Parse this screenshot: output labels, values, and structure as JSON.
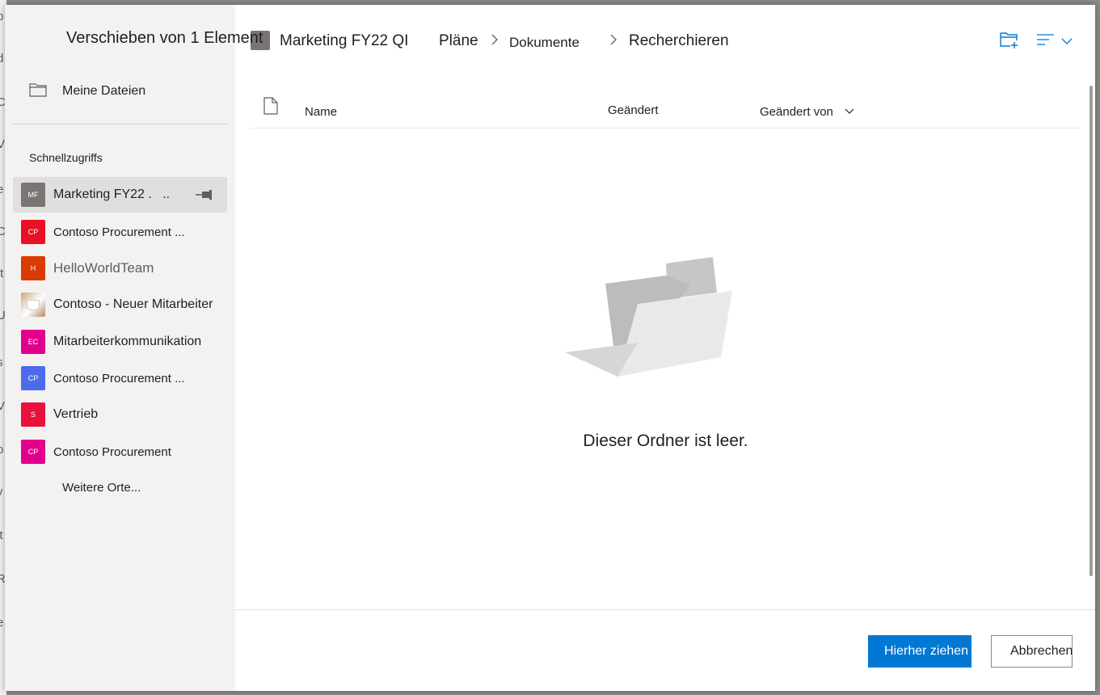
{
  "dialog": {
    "title": "Verschieben von 1 Element"
  },
  "sidebar": {
    "my_files": "Meine Dateien",
    "quick_access_header": "Schnellzugriffs",
    "items": [
      {
        "initials": "MF",
        "label": "Marketing FY22 .   ..",
        "color": "#7a7574",
        "selected": true
      },
      {
        "initials": "CP",
        "label": "Contoso Procurement ...",
        "color": "#e81123"
      },
      {
        "initials": "H",
        "label": "HelloWorldTeam",
        "color": "#da3b01"
      },
      {
        "initials": "",
        "label": "Contoso - Neuer Mitarbeiter",
        "color": "#c8a27a"
      },
      {
        "initials": "EC",
        "label": "Mitarbeiterkommunikation",
        "color": "#e3008c"
      },
      {
        "initials": "CP",
        "label": "Contoso Procurement ...",
        "color": "#4f6bed"
      },
      {
        "initials": "S",
        "label": "Vertrieb",
        "color": "#e8123c"
      },
      {
        "initials": "CP",
        "label": "Contoso Procurement",
        "color": "#e3008c"
      }
    ],
    "more_places": "Weitere Orte..."
  },
  "breadcrumb": {
    "items": [
      "Marketing FY22 QI",
      "Pläne",
      "Dokumente",
      "Recherchieren"
    ]
  },
  "table": {
    "columns": {
      "name": "Name",
      "modified": "Geändert",
      "modified_by": "Geändert von"
    }
  },
  "empty_state": {
    "message": "Dieser Ordner ist leer."
  },
  "footer": {
    "move_here_label": "Hierher ziehen",
    "cancel_label": "Abbrechen"
  },
  "backdrop": {
    "letters": [
      "p",
      "d",
      "C",
      "V",
      "e",
      "C",
      "ft",
      "U",
      "s",
      "V",
      "o",
      "v",
      "lt",
      "R",
      "e"
    ]
  },
  "colors": {
    "accent": "#0078d4",
    "sidebar_bg": "#f3f2f1",
    "selected_bg": "#e1dfdd"
  }
}
